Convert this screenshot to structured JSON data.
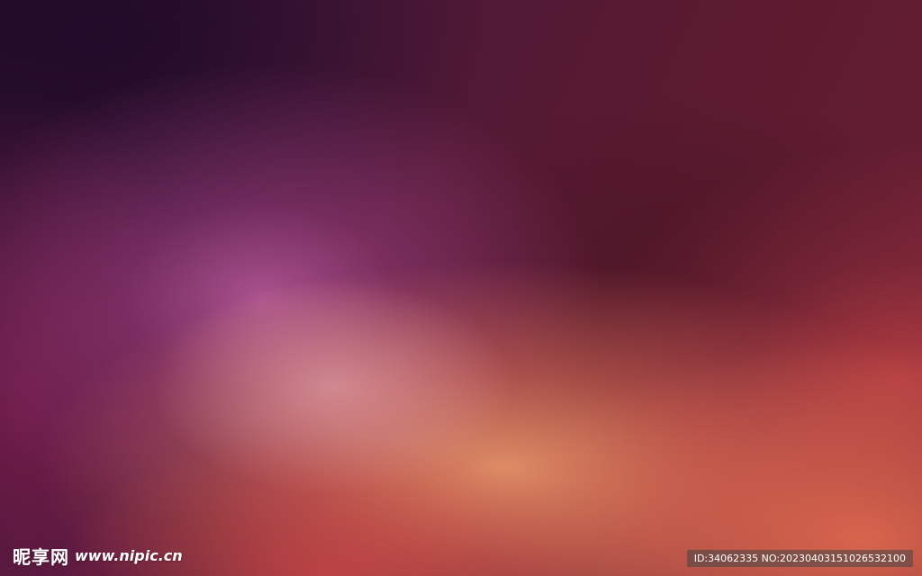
{
  "watermark": {
    "logo_text": "昵享网",
    "url": "www.nipic.cn",
    "id_label": "ID:34062335 NO:20230403151026532100"
  },
  "colors": {
    "deep_purple": "#2a0f2e",
    "plum": "#5a1a30",
    "pink_glow": "#c864aa",
    "peach": "#f5a06e",
    "orange_red": "#e66e50"
  }
}
